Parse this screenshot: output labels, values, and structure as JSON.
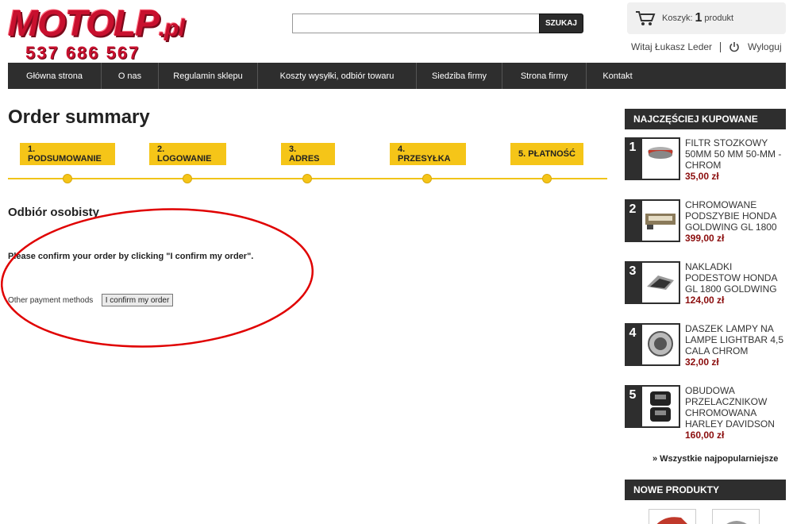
{
  "header": {
    "logo_main": "MOTOLP",
    "logo_suffix": ".pl",
    "logo_phone": "537 686 567",
    "search_placeholder": "",
    "search_button": "SZUKAJ",
    "cart_label": "Koszyk:",
    "cart_count": "1",
    "cart_unit": "produkt",
    "user_greeting": "Witaj Łukasz Leder",
    "logout_label": "Wyloguj"
  },
  "nav": {
    "items": [
      {
        "label": "Główna strona"
      },
      {
        "label": "O nas"
      },
      {
        "label": "Regulamin sklepu"
      },
      {
        "label": "Koszty wysyłki, odbiór towaru"
      },
      {
        "label": "Siedziba firmy"
      },
      {
        "label": "Strona firmy"
      },
      {
        "label": "Kontakt"
      }
    ]
  },
  "main": {
    "title": "Order summary",
    "steps": [
      {
        "label": "1. PODSUMOWANIE"
      },
      {
        "label": "2. LOGOWANIE"
      },
      {
        "label": "3. ADRES"
      },
      {
        "label": "4. PRZESYŁKA"
      },
      {
        "label": "5. PŁATNOŚĆ"
      }
    ],
    "section_title": "Odbiór osobisty",
    "confirm_text": "Please confirm your order by clicking \"I confirm my order\".",
    "other_methods": "Other payment methods",
    "confirm_button": "I confirm my order"
  },
  "sidebar": {
    "popular_title": "NAJCZĘŚCIEJ KUPOWANE",
    "products": [
      {
        "rank": "1",
        "name": "FILTR STOZKOWY 50MM 50 MM 50-MM - CHROM",
        "price": "35,00 zł"
      },
      {
        "rank": "2",
        "name": "CHROMOWANE PODSZYBIE HONDA GOLDWING GL 1800",
        "price": "399,00 zł"
      },
      {
        "rank": "3",
        "name": "NAKLADKI PODESTOW HONDA GL 1800 GOLDWING",
        "price": "124,00 zł"
      },
      {
        "rank": "4",
        "name": "DASZEK LAMPY NA LAMPE LIGHTBAR 4,5 CALA CHROM",
        "price": "32,00 zł"
      },
      {
        "rank": "5",
        "name": "OBUDOWA PRZELACZNIKOW CHROMOWANA HARLEY DAVIDSON",
        "price": "160,00 zł"
      }
    ],
    "all_popular": "» Wszystkie najpopularniejsze",
    "new_title": "NOWE PRODUKTY"
  },
  "colors": {
    "accent_yellow": "#f5c518",
    "nav_dark": "#2e2e2e",
    "price_red": "#8b0d0d",
    "logo_red": "#c8102e",
    "annotation_red": "#e00000"
  }
}
